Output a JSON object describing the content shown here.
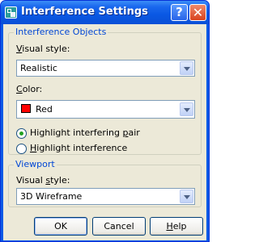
{
  "window": {
    "title": "Interference Settings"
  },
  "icons": {
    "app": "interference-app-icon",
    "help": "help-icon",
    "close": "close-icon"
  },
  "interference_objects": {
    "group_title": "Interference Objects",
    "visual_style": {
      "label_ul": "V",
      "label_rest": "isual style:",
      "value": "Realistic"
    },
    "color": {
      "label_ul": "C",
      "label_rest": "olor:",
      "value": "Red",
      "swatch": "#ff0000"
    },
    "highlight_pair": {
      "pre": "Highlight interfering ",
      "ul": "p",
      "post": "air",
      "selected": true
    },
    "highlight_interference": {
      "pre": "",
      "ul": "H",
      "post": "ighlight interference",
      "selected": false
    }
  },
  "viewport": {
    "group_title": "Viewport",
    "visual_style": {
      "label_pre": "Visual ",
      "label_ul": "s",
      "label_post": "tyle:",
      "value": "3D Wireframe"
    }
  },
  "buttons": {
    "ok": "OK",
    "cancel": "Cancel",
    "help_ul": "H",
    "help_rest": "elp"
  },
  "colors": {
    "titlebar": "#0a58e3",
    "client": "#ece9d8",
    "group_title": "#0046d5",
    "radio_dot": "#21a121"
  }
}
